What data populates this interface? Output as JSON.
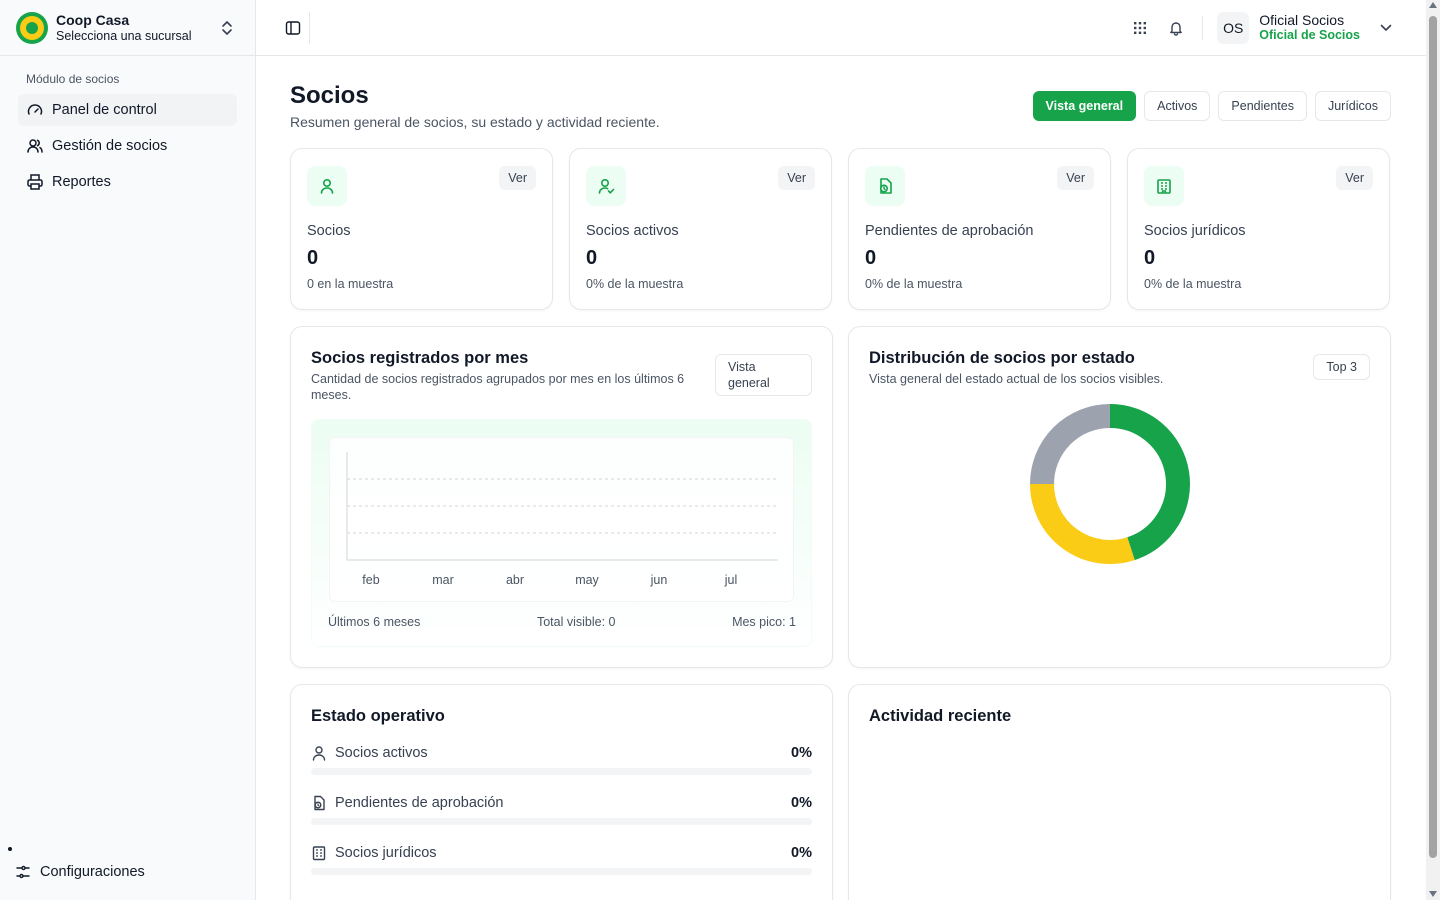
{
  "brand": {
    "name": "Coop Casa",
    "subtitle": "Selecciona una sucursal"
  },
  "sidebar": {
    "section_label": "Módulo de socios",
    "items": [
      {
        "label": "Panel de control",
        "icon": "gauge-icon",
        "active": true
      },
      {
        "label": "Gestión de socios",
        "icon": "users-icon"
      },
      {
        "label": "Reportes",
        "icon": "printer-icon"
      }
    ],
    "settings_label": "Configuraciones"
  },
  "user": {
    "initials": "OS",
    "name": "Oficial Socios",
    "role": "Oficial de Socios"
  },
  "page": {
    "title": "Socios",
    "subtitle": "Resumen general de socios, su estado y actividad reciente.",
    "tabs": [
      "Vista general",
      "Activos",
      "Pendientes",
      "Jurídicos"
    ]
  },
  "stats": [
    {
      "label": "Socios",
      "value": "0",
      "note": "0 en la muestra",
      "action": "Ver",
      "icon": "user-icon"
    },
    {
      "label": "Socios activos",
      "value": "0",
      "note": "0% de la muestra",
      "action": "Ver",
      "icon": "user-check-icon"
    },
    {
      "label": "Pendientes de aprobación",
      "value": "0",
      "note": "0% de la muestra",
      "action": "Ver",
      "icon": "file-clock-icon"
    },
    {
      "label": "Socios jurídicos",
      "value": "0",
      "note": "0% de la muestra",
      "action": "Ver",
      "icon": "building-icon"
    }
  ],
  "monthly_chart": {
    "title": "Socios registrados por mes",
    "subtitle": "Cantidad de socios registrados agrupados por mes en los últimos 6 meses.",
    "selector": "Vista general",
    "footer_left": "Últimos 6 meses",
    "footer_mid": "Total visible: 0",
    "footer_right": "Mes pico: 1"
  },
  "donut_chart": {
    "title": "Distribución de socios por estado",
    "subtitle": "Vista general del estado actual de los socios visibles.",
    "selector": "Top 3"
  },
  "operativo": {
    "title": "Estado operativo",
    "rows": [
      {
        "label": "Socios activos",
        "value": "0%",
        "fraction": 0,
        "icon": "user-icon"
      },
      {
        "label": "Pendientes de aprobación",
        "value": "0%",
        "fraction": 0,
        "icon": "file-clock-icon"
      },
      {
        "label": "Socios jurídicos",
        "value": "0%",
        "fraction": 0,
        "icon": "building-icon"
      }
    ]
  },
  "activity": {
    "title": "Actividad reciente"
  },
  "chart_data": [
    {
      "type": "bar",
      "categories": [
        "feb",
        "mar",
        "abr",
        "may",
        "jun",
        "jul"
      ],
      "values": [
        0,
        0,
        0,
        0,
        0,
        0
      ],
      "title": "Socios registrados por mes",
      "xlabel": "",
      "ylabel": "",
      "ylim": [
        0,
        1
      ],
      "grid": true
    },
    {
      "type": "pie",
      "donut": true,
      "values": [
        45,
        30,
        25
      ],
      "colors": [
        "#16a34a",
        "#facc15",
        "#9ca3af"
      ],
      "title": "Distribución de socios por estado"
    }
  ],
  "colors": {
    "accent": "#16a34a",
    "accent_soft": "#ecfdf3",
    "warning": "#facc15",
    "neutral": "#9ca3af"
  }
}
